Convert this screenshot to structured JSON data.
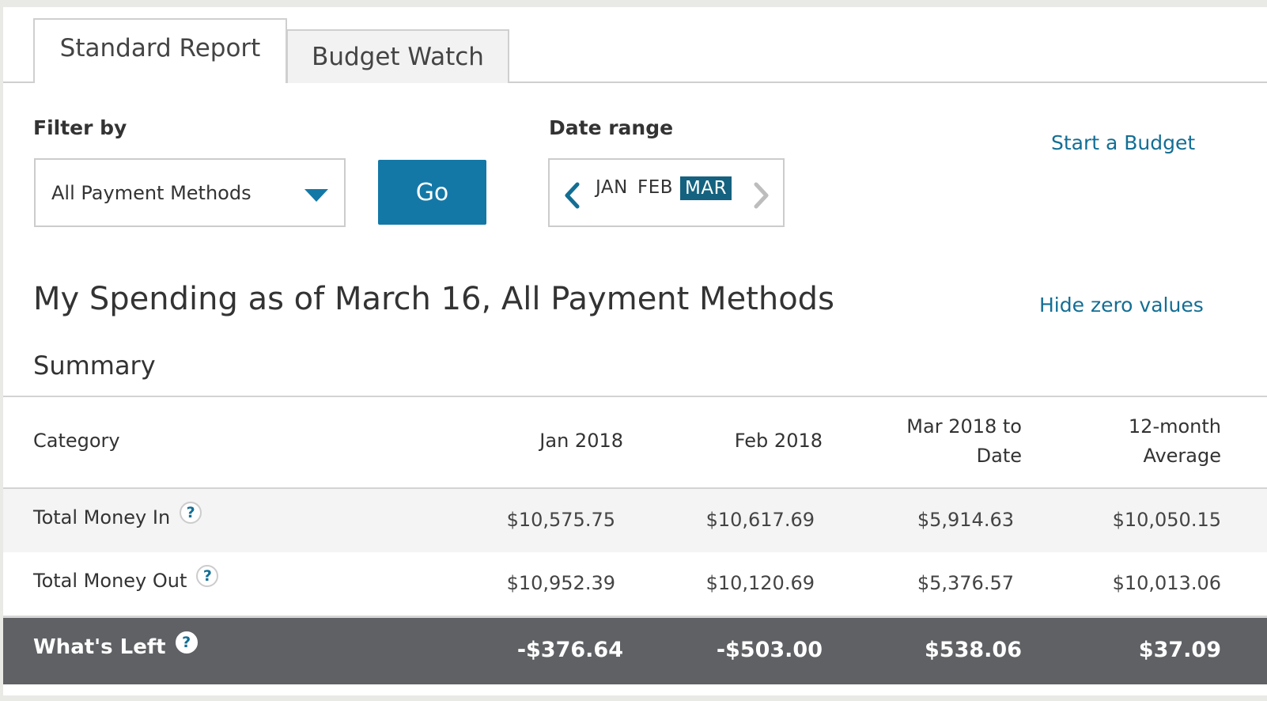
{
  "tabs": [
    {
      "label": "Standard Report",
      "active": true
    },
    {
      "label": "Budget Watch",
      "active": false
    }
  ],
  "filter": {
    "label": "Filter by",
    "selected": "All Payment Methods",
    "go_label": "Go"
  },
  "date_range": {
    "label": "Date range",
    "months": [
      "JAN",
      "FEB",
      "MAR"
    ],
    "selected_month": "MAR"
  },
  "links": {
    "start_budget": "Start a Budget",
    "hide_zero": "Hide zero values"
  },
  "heading": "My Spending as of March 16, All Payment Methods",
  "summary_title": "Summary",
  "table": {
    "headers": {
      "category": "Category",
      "jan": "Jan 2018",
      "feb": "Feb 2018",
      "mar_line1": "Mar 2018 to",
      "mar_line2": "Date",
      "avg_line1": "12-month",
      "avg_line2": "Average"
    },
    "rows": [
      {
        "category": "Total Money In",
        "jan": "$10,575.75",
        "feb": "$10,617.69",
        "mar": "$5,914.63",
        "avg": "$10,050.15"
      },
      {
        "category": "Total Money Out",
        "jan": "$10,952.39",
        "feb": "$10,120.69",
        "mar": "$5,376.57",
        "avg": "$10,013.06"
      }
    ],
    "total": {
      "category": "What's Left",
      "jan": "-$376.64",
      "feb": "-$503.00",
      "mar": "$538.06",
      "avg": "$37.09"
    }
  },
  "help_symbol": "?",
  "colors": {
    "accent": "#1478a7",
    "selected_month_bg": "#14627f",
    "link": "#136e94",
    "total_row_bg": "#5f6164",
    "money_in_row_bg": "#f4f4f4"
  },
  "icons": [
    "caret-down-icon",
    "chevron-left-icon",
    "chevron-right-icon",
    "help-icon"
  ]
}
